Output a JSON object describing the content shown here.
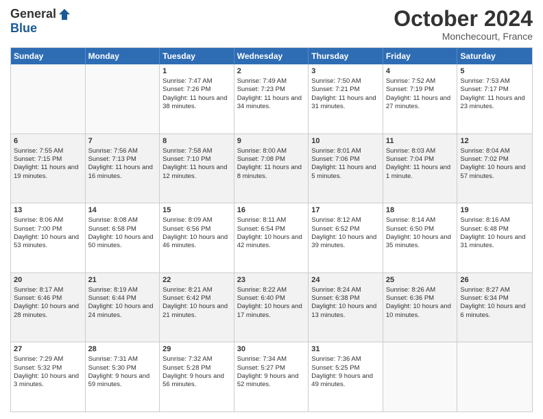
{
  "header": {
    "logo_general": "General",
    "logo_blue": "Blue",
    "month_title": "October 2024",
    "location": "Monchecourt, France"
  },
  "calendar": {
    "days_of_week": [
      "Sunday",
      "Monday",
      "Tuesday",
      "Wednesday",
      "Thursday",
      "Friday",
      "Saturday"
    ],
    "rows": [
      [
        {
          "day": "",
          "sunrise": "",
          "sunset": "",
          "daylight": "",
          "empty": true
        },
        {
          "day": "",
          "sunrise": "",
          "sunset": "",
          "daylight": "",
          "empty": true
        },
        {
          "day": "1",
          "sunrise": "Sunrise: 7:47 AM",
          "sunset": "Sunset: 7:26 PM",
          "daylight": "Daylight: 11 hours and 38 minutes."
        },
        {
          "day": "2",
          "sunrise": "Sunrise: 7:49 AM",
          "sunset": "Sunset: 7:23 PM",
          "daylight": "Daylight: 11 hours and 34 minutes."
        },
        {
          "day": "3",
          "sunrise": "Sunrise: 7:50 AM",
          "sunset": "Sunset: 7:21 PM",
          "daylight": "Daylight: 11 hours and 31 minutes."
        },
        {
          "day": "4",
          "sunrise": "Sunrise: 7:52 AM",
          "sunset": "Sunset: 7:19 PM",
          "daylight": "Daylight: 11 hours and 27 minutes."
        },
        {
          "day": "5",
          "sunrise": "Sunrise: 7:53 AM",
          "sunset": "Sunset: 7:17 PM",
          "daylight": "Daylight: 11 hours and 23 minutes."
        }
      ],
      [
        {
          "day": "6",
          "sunrise": "Sunrise: 7:55 AM",
          "sunset": "Sunset: 7:15 PM",
          "daylight": "Daylight: 11 hours and 19 minutes."
        },
        {
          "day": "7",
          "sunrise": "Sunrise: 7:56 AM",
          "sunset": "Sunset: 7:13 PM",
          "daylight": "Daylight: 11 hours and 16 minutes."
        },
        {
          "day": "8",
          "sunrise": "Sunrise: 7:58 AM",
          "sunset": "Sunset: 7:10 PM",
          "daylight": "Daylight: 11 hours and 12 minutes."
        },
        {
          "day": "9",
          "sunrise": "Sunrise: 8:00 AM",
          "sunset": "Sunset: 7:08 PM",
          "daylight": "Daylight: 11 hours and 8 minutes."
        },
        {
          "day": "10",
          "sunrise": "Sunrise: 8:01 AM",
          "sunset": "Sunset: 7:06 PM",
          "daylight": "Daylight: 11 hours and 5 minutes."
        },
        {
          "day": "11",
          "sunrise": "Sunrise: 8:03 AM",
          "sunset": "Sunset: 7:04 PM",
          "daylight": "Daylight: 11 hours and 1 minute."
        },
        {
          "day": "12",
          "sunrise": "Sunrise: 8:04 AM",
          "sunset": "Sunset: 7:02 PM",
          "daylight": "Daylight: 10 hours and 57 minutes."
        }
      ],
      [
        {
          "day": "13",
          "sunrise": "Sunrise: 8:06 AM",
          "sunset": "Sunset: 7:00 PM",
          "daylight": "Daylight: 10 hours and 53 minutes."
        },
        {
          "day": "14",
          "sunrise": "Sunrise: 8:08 AM",
          "sunset": "Sunset: 6:58 PM",
          "daylight": "Daylight: 10 hours and 50 minutes."
        },
        {
          "day": "15",
          "sunrise": "Sunrise: 8:09 AM",
          "sunset": "Sunset: 6:56 PM",
          "daylight": "Daylight: 10 hours and 46 minutes."
        },
        {
          "day": "16",
          "sunrise": "Sunrise: 8:11 AM",
          "sunset": "Sunset: 6:54 PM",
          "daylight": "Daylight: 10 hours and 42 minutes."
        },
        {
          "day": "17",
          "sunrise": "Sunrise: 8:12 AM",
          "sunset": "Sunset: 6:52 PM",
          "daylight": "Daylight: 10 hours and 39 minutes."
        },
        {
          "day": "18",
          "sunrise": "Sunrise: 8:14 AM",
          "sunset": "Sunset: 6:50 PM",
          "daylight": "Daylight: 10 hours and 35 minutes."
        },
        {
          "day": "19",
          "sunrise": "Sunrise: 8:16 AM",
          "sunset": "Sunset: 6:48 PM",
          "daylight": "Daylight: 10 hours and 31 minutes."
        }
      ],
      [
        {
          "day": "20",
          "sunrise": "Sunrise: 8:17 AM",
          "sunset": "Sunset: 6:46 PM",
          "daylight": "Daylight: 10 hours and 28 minutes."
        },
        {
          "day": "21",
          "sunrise": "Sunrise: 8:19 AM",
          "sunset": "Sunset: 6:44 PM",
          "daylight": "Daylight: 10 hours and 24 minutes."
        },
        {
          "day": "22",
          "sunrise": "Sunrise: 8:21 AM",
          "sunset": "Sunset: 6:42 PM",
          "daylight": "Daylight: 10 hours and 21 minutes."
        },
        {
          "day": "23",
          "sunrise": "Sunrise: 8:22 AM",
          "sunset": "Sunset: 6:40 PM",
          "daylight": "Daylight: 10 hours and 17 minutes."
        },
        {
          "day": "24",
          "sunrise": "Sunrise: 8:24 AM",
          "sunset": "Sunset: 6:38 PM",
          "daylight": "Daylight: 10 hours and 13 minutes."
        },
        {
          "day": "25",
          "sunrise": "Sunrise: 8:26 AM",
          "sunset": "Sunset: 6:36 PM",
          "daylight": "Daylight: 10 hours and 10 minutes."
        },
        {
          "day": "26",
          "sunrise": "Sunrise: 8:27 AM",
          "sunset": "Sunset: 6:34 PM",
          "daylight": "Daylight: 10 hours and 6 minutes."
        }
      ],
      [
        {
          "day": "27",
          "sunrise": "Sunrise: 7:29 AM",
          "sunset": "Sunset: 5:32 PM",
          "daylight": "Daylight: 10 hours and 3 minutes."
        },
        {
          "day": "28",
          "sunrise": "Sunrise: 7:31 AM",
          "sunset": "Sunset: 5:30 PM",
          "daylight": "Daylight: 9 hours and 59 minutes."
        },
        {
          "day": "29",
          "sunrise": "Sunrise: 7:32 AM",
          "sunset": "Sunset: 5:28 PM",
          "daylight": "Daylight: 9 hours and 56 minutes."
        },
        {
          "day": "30",
          "sunrise": "Sunrise: 7:34 AM",
          "sunset": "Sunset: 5:27 PM",
          "daylight": "Daylight: 9 hours and 52 minutes."
        },
        {
          "day": "31",
          "sunrise": "Sunrise: 7:36 AM",
          "sunset": "Sunset: 5:25 PM",
          "daylight": "Daylight: 9 hours and 49 minutes."
        },
        {
          "day": "",
          "sunrise": "",
          "sunset": "",
          "daylight": "",
          "empty": true
        },
        {
          "day": "",
          "sunrise": "",
          "sunset": "",
          "daylight": "",
          "empty": true
        }
      ]
    ]
  }
}
